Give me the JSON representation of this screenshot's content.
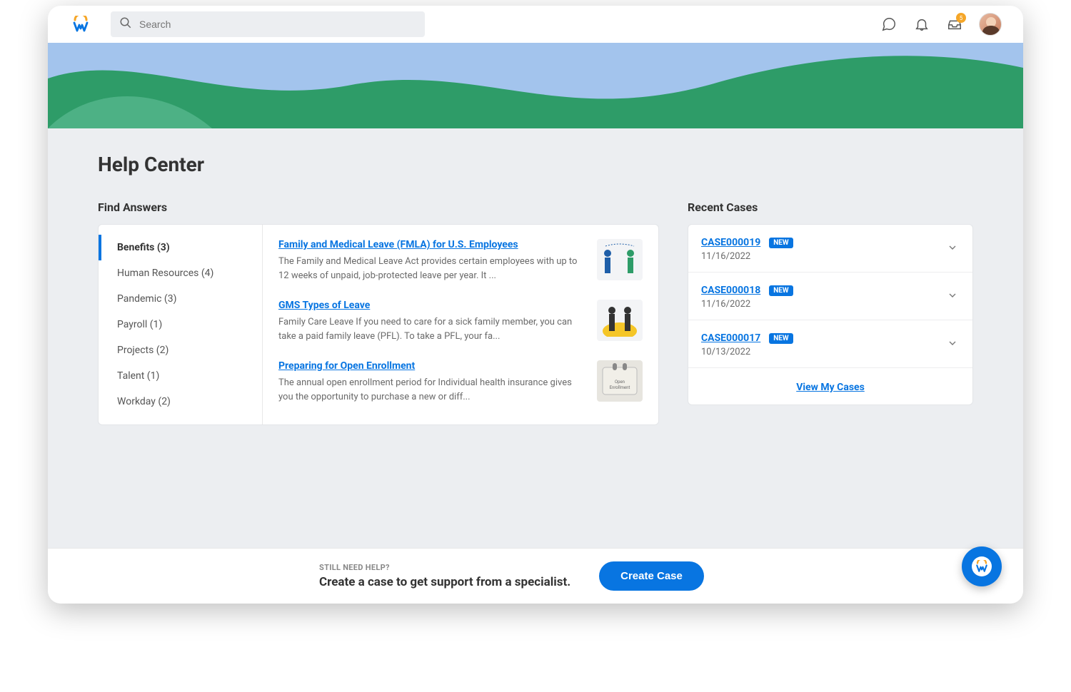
{
  "search": {
    "placeholder": "Search"
  },
  "inbox": {
    "badge": "5"
  },
  "page": {
    "title": "Help Center"
  },
  "findAnswers": {
    "heading": "Find Answers",
    "categories": [
      {
        "label": "Benefits (3)",
        "active": true
      },
      {
        "label": "Human Resources (4)"
      },
      {
        "label": "Pandemic (3)"
      },
      {
        "label": "Payroll (1)"
      },
      {
        "label": "Projects (2)"
      },
      {
        "label": "Talent (1)"
      },
      {
        "label": "Workday (2)"
      }
    ],
    "articles": [
      {
        "title": "Family and Medical Leave (FMLA) for U.S. Employees",
        "desc": "The Family and Medical Leave Act provides certain employees with up to 12 weeks of unpaid, job-protected leave per year. It ..."
      },
      {
        "title": "GMS Types of Leave",
        "desc": "Family Care Leave If you need to care for a sick family member, you can take a paid family leave (PFL). To take a PFL, your fa..."
      },
      {
        "title": "Preparing for Open Enrollment",
        "desc": "The annual open enrollment period for Individual health insurance gives you the opportunity to purchase a new or diff..."
      }
    ]
  },
  "recentCases": {
    "heading": "Recent Cases",
    "badgeLabel": "NEW",
    "cases": [
      {
        "id": "CASE000019",
        "date": "11/16/2022"
      },
      {
        "id": "CASE000018",
        "date": "11/16/2022"
      },
      {
        "id": "CASE000017",
        "date": "10/13/2022"
      }
    ],
    "footerLink": "View My Cases"
  },
  "bottom": {
    "kicker": "STILL NEED HELP?",
    "title": "Create a case to get support from a specialist.",
    "button": "Create Case"
  }
}
